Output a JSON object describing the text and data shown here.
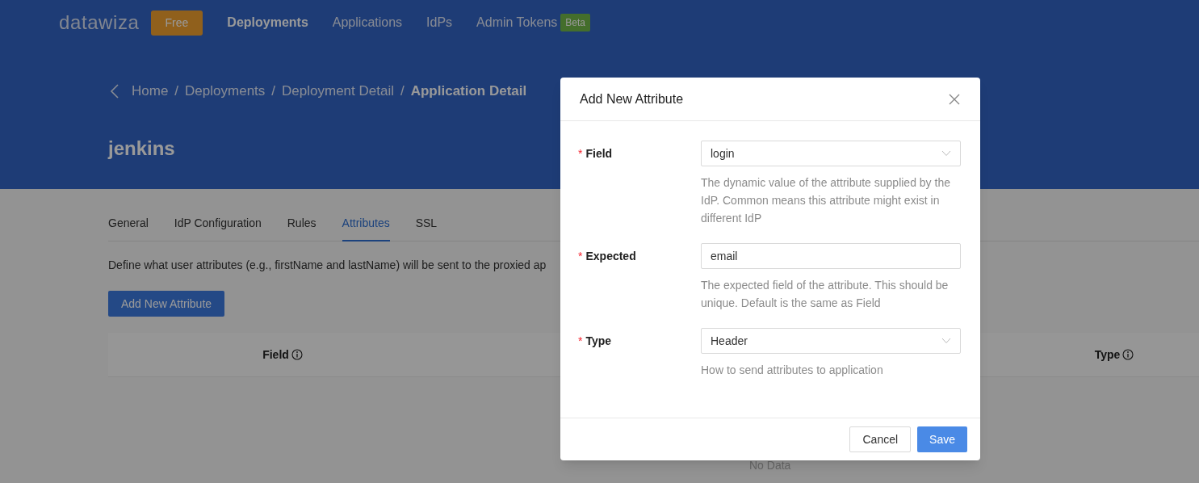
{
  "nav": {
    "logo": "datawiza",
    "plan_badge": "Free",
    "items": [
      {
        "label": "Deployments",
        "selected": true
      },
      {
        "label": "Applications",
        "selected": false
      },
      {
        "label": "IdPs",
        "selected": false
      },
      {
        "label": "Admin Tokens",
        "selected": false,
        "badge": "Beta"
      }
    ]
  },
  "breadcrumb": [
    {
      "label": "Home",
      "current": false
    },
    {
      "label": "Deployments",
      "current": false
    },
    {
      "label": "Deployment Detail",
      "current": false
    },
    {
      "label": "Application Detail",
      "current": true
    }
  ],
  "breadcrumb_separator": "/",
  "page_title": "jenkins",
  "tabs": [
    {
      "label": "General",
      "selected": false
    },
    {
      "label": "IdP Configuration",
      "selected": false
    },
    {
      "label": "Rules",
      "selected": false
    },
    {
      "label": "Attributes",
      "selected": true
    },
    {
      "label": "SSL",
      "selected": false
    }
  ],
  "description": "Define what user attributes (e.g., firstName and lastName) will be sent to the proxied ap",
  "add_button": "Add New Attribute",
  "table": {
    "columns": [
      "Field",
      "Type"
    ],
    "empty_text": "No Data"
  },
  "modal": {
    "title": "Add New Attribute",
    "fields": [
      {
        "label": "Field",
        "required": true,
        "kind": "select",
        "value": "login",
        "help": "The dynamic value of the attribute supplied by the IdP. Common means this attribute might exist in different IdP"
      },
      {
        "label": "Expected",
        "required": true,
        "kind": "input",
        "value": "email",
        "help": "The expected field of the attribute. This should be unique. Default is the same as Field"
      },
      {
        "label": "Type",
        "required": true,
        "kind": "select",
        "value": "Header",
        "help": "How to send attributes to application"
      }
    ],
    "required_mark": "*",
    "buttons": [
      {
        "label": "Cancel",
        "kind": "secondary"
      },
      {
        "label": "Save",
        "kind": "primary"
      }
    ]
  }
}
